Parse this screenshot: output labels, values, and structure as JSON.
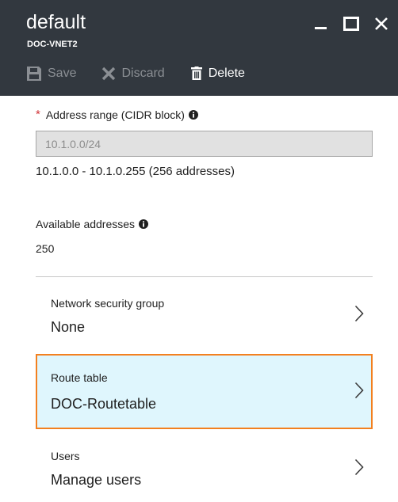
{
  "header": {
    "title": "default",
    "subtitle": "DOC-VNET2",
    "window_controls": [
      "minimize-icon",
      "maximize-icon",
      "close-icon"
    ]
  },
  "toolbar": {
    "save": {
      "label": "Save",
      "icon": "save-icon",
      "enabled": false
    },
    "discard": {
      "label": "Discard",
      "icon": "discard-x-icon",
      "enabled": false
    },
    "delete": {
      "label": "Delete",
      "icon": "trash-icon",
      "enabled": true
    }
  },
  "address_range": {
    "required_marker": "*",
    "label": "Address range (CIDR block)",
    "value": "10.1.0.0/24",
    "range_text": "10.1.0.0 - 10.1.0.255 (256 addresses)"
  },
  "available_addresses": {
    "label": "Available addresses",
    "value": "250"
  },
  "nav_rows": [
    {
      "label": "Network security group",
      "value": "None",
      "selected": false
    },
    {
      "label": "Route table",
      "value": "DOC-Routetable",
      "selected": true
    },
    {
      "label": "Users",
      "value": "Manage users",
      "selected": false
    }
  ],
  "colors": {
    "header_bg": "#32383f",
    "selected_row_bg": "#dff6fd",
    "selected_row_border": "#f3801f",
    "required_star": "#d13438",
    "disabled_text": "#8b8f94"
  }
}
